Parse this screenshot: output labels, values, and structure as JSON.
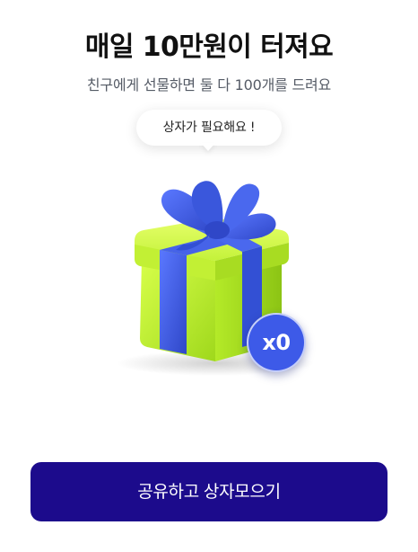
{
  "header": {
    "title": "매일 10만원이 터져요",
    "subtitle": "친구에게 선물하면 둘 다 100개를 드려요"
  },
  "tooltip": {
    "text": "상자가 필요해요 !"
  },
  "gift": {
    "icon": "gift-box-icon",
    "count_label": "x0",
    "colors": {
      "box": "#c6f23a",
      "ribbon": "#3f5ce0",
      "badge": "#3d5ae8"
    }
  },
  "cta": {
    "label": "공유하고 상자모으기",
    "color": "#1c0b8c"
  }
}
